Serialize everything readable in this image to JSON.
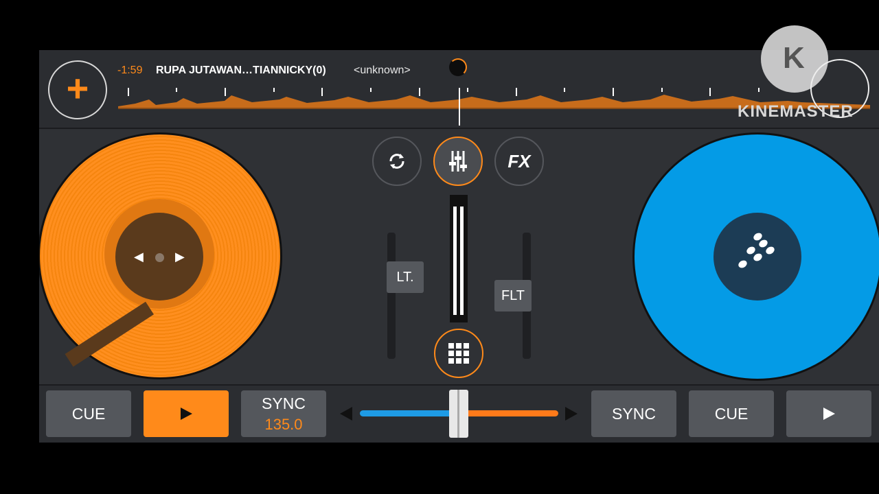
{
  "header": {
    "time": "-1:59",
    "track_title": "RUPA JUTAWAN…TIANNICKY(0)",
    "track_artist": "<unknown>",
    "add_label": "+"
  },
  "mixer": {
    "fx_label": "FX",
    "filter_left_label": "LT.",
    "filter_right_label": "FLT"
  },
  "left_deck": {
    "cue_label": "CUE",
    "sync_label": "SYNC",
    "bpm": "135.0",
    "color": "#ff8a1a"
  },
  "right_deck": {
    "cue_label": "CUE",
    "sync_label": "SYNC",
    "color": "#049be6"
  },
  "watermark": {
    "text": "KINEMASTER",
    "logo_letter": "K"
  },
  "icons": [
    "add-icon",
    "sync-loop-icon",
    "mixer-sliders-icon",
    "pads-grid-icon",
    "play-icon"
  ]
}
